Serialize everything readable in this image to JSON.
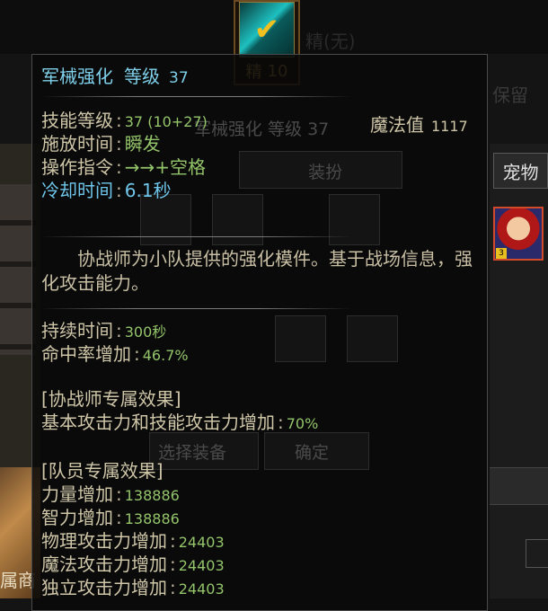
{
  "background": {
    "left_text": "属商",
    "pet_tab": "宠物",
    "top_faded": "精(无)",
    "right_top_faded": "保留",
    "avatar_badge": "3",
    "ghost_skill_title": "军械强化 等级 37",
    "ghost_button_equip": "装扮",
    "ghost_button_select": "选择装备",
    "ghost_button_confirm": "确定"
  },
  "skill_icon": {
    "icon": "check-icon",
    "rank_label": "精",
    "rank_value": "10"
  },
  "tooltip": {
    "title": "军械强化",
    "level_label": "等级",
    "level_value": "37",
    "stats": [
      {
        "label": "技能等级",
        "value": "37 (10+27)"
      },
      {
        "label": "施放时间",
        "value": "瞬发"
      },
      {
        "label": "操作指令",
        "value": "→→+空格"
      },
      {
        "label": "冷却时间",
        "value": "6.1秒"
      }
    ],
    "mana_label": "魔法值",
    "mana_value": "1117",
    "description": "协战师为小队提供的强化模件。基于战场信息，强化攻击能力。",
    "effects": [
      {
        "label": "持续时间",
        "value": "300秒"
      },
      {
        "label": "命中率增加",
        "value": "46.7%"
      }
    ],
    "exclusive_header": "[协战师专属效果]",
    "exclusive_line": {
      "label": "基本攻击力和技能攻击力增加",
      "value": "70%"
    },
    "party_header": "[队员专属效果]",
    "party_effects": [
      {
        "label": "力量增加",
        "value": "138886"
      },
      {
        "label": "智力增加",
        "value": "138886"
      },
      {
        "label": "物理攻击力增加",
        "value": "24403"
      },
      {
        "label": "魔法攻击力增加",
        "value": "24403"
      },
      {
        "label": "独立攻击力增加",
        "value": "24403"
      }
    ]
  },
  "colors": {
    "title": "#7fd0ea",
    "label": "#cfc6a8",
    "value_green": "#93c46a",
    "cooldown_blue": "#6fc6ea"
  }
}
